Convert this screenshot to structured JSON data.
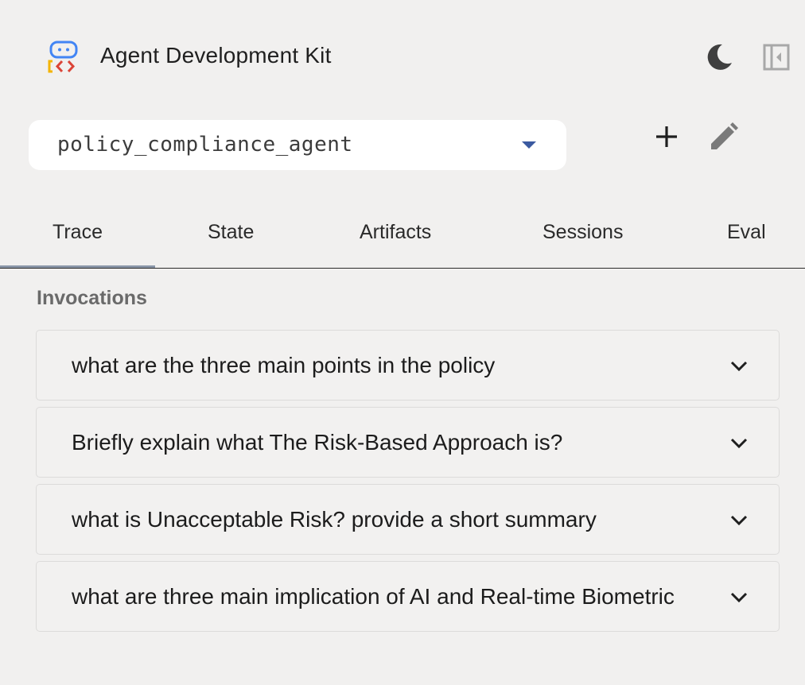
{
  "header": {
    "title": "Agent Development Kit",
    "logo_icon": "adk-logo-icon",
    "theme_icon": "moon-icon",
    "sidebar_icon": "collapse-sidebar-icon"
  },
  "agent_selector": {
    "value": "policy_compliance_agent",
    "add_icon": "plus-icon",
    "edit_icon": "pencil-icon"
  },
  "tabs": [
    {
      "label": "Trace",
      "active": true
    },
    {
      "label": "State",
      "active": false
    },
    {
      "label": "Artifacts",
      "active": false
    },
    {
      "label": "Sessions",
      "active": false
    },
    {
      "label": "Eval",
      "active": false
    }
  ],
  "invocations": {
    "heading": "Invocations",
    "items": [
      {
        "text": "what are the three main points in the policy"
      },
      {
        "text": "Briefly explain what The Risk-Based Approach is?"
      },
      {
        "text": "what is Unacceptable Risk? provide a short summary"
      },
      {
        "text": "what are three main implication of AI and Real-time Biometric"
      }
    ]
  },
  "colors": {
    "background": "#f1f0ef",
    "select_caret": "#3b5aa0",
    "active_tab_indicator": "#8a96a8",
    "logo_blue": "#4285f4",
    "logo_yellow": "#f4b400",
    "logo_red": "#db4437"
  }
}
